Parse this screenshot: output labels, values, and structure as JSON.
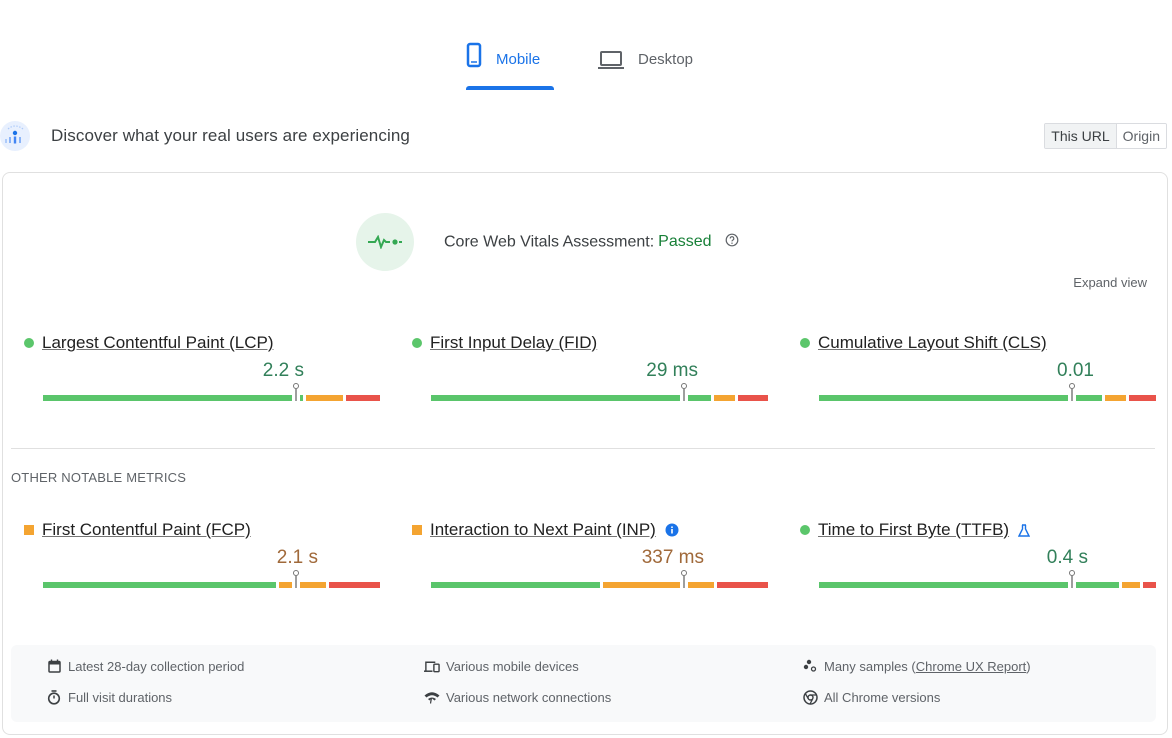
{
  "tabs": [
    {
      "label": "Mobile",
      "icon": "smartphone-icon",
      "active": true
    },
    {
      "label": "Desktop",
      "icon": "laptop-icon",
      "active": false
    }
  ],
  "crux": {
    "title": "Discover what your real users are experiencing",
    "icon": "crux-logo-icon",
    "scope_toggle": {
      "options": [
        "This URL",
        "Origin"
      ],
      "selected": "This URL"
    }
  },
  "assessment": {
    "label": "Core Web Vitals Assessment:",
    "status": "Passed",
    "icon": "pulse-icon",
    "help_icon": "help-circle-icon"
  },
  "expand_view_label": "Expand view",
  "colors": {
    "accent": "#1a73e8",
    "good": "#5ac56b",
    "needs_improvement": "#f4a431",
    "poor": "#e9534a",
    "good_text": "#32805a",
    "avg_text": "#a0693a"
  },
  "core_metrics": [
    {
      "name": "Largest Contentful Paint (LCP)",
      "value": "2.2 s",
      "rating": "good",
      "distribution": {
        "good": 0.78,
        "needs_improvement": 0.12,
        "poor": 0.1
      },
      "marker": 0.75
    },
    {
      "name": "First Input Delay (FID)",
      "value": "29 ms",
      "rating": "good",
      "distribution": {
        "good": 0.84,
        "needs_improvement": 0.07,
        "poor": 0.09
      },
      "marker": 0.75
    },
    {
      "name": "Cumulative Layout Shift (CLS)",
      "value": "0.01",
      "rating": "good",
      "distribution": {
        "good": 0.85,
        "needs_improvement": 0.07,
        "poor": 0.08
      },
      "marker": 0.75
    }
  ],
  "other_section_label": "OTHER NOTABLE METRICS",
  "other_metrics": [
    {
      "name": "First Contentful Paint (FCP)",
      "value": "2.1 s",
      "rating": "needs_improvement",
      "distribution": {
        "good": 0.7,
        "needs_improvement": 0.15,
        "poor": 0.15
      },
      "marker": 0.75,
      "extra_icon": null
    },
    {
      "name": "Interaction to Next Paint (INP)",
      "value": "337 ms",
      "rating": "needs_improvement",
      "distribution": {
        "good": 0.51,
        "needs_improvement": 0.34,
        "poor": 0.15
      },
      "marker": 0.75,
      "extra_icon": "info-icon"
    },
    {
      "name": "Time to First Byte (TTFB)",
      "value": "0.4 s",
      "rating": "good",
      "distribution": {
        "good": 0.9,
        "needs_improvement": 0.06,
        "poor": 0.04
      },
      "marker": 0.75,
      "extra_icon": "experimental-flask-icon"
    }
  ],
  "info": {
    "collection_period": "Latest 28-day collection period",
    "visit_durations": "Full visit durations",
    "devices": "Various mobile devices",
    "network": "Various network connections",
    "samples_prefix": "Many samples (",
    "samples_link": "Chrome UX Report",
    "samples_suffix": ")",
    "chrome_versions": "All Chrome versions"
  }
}
